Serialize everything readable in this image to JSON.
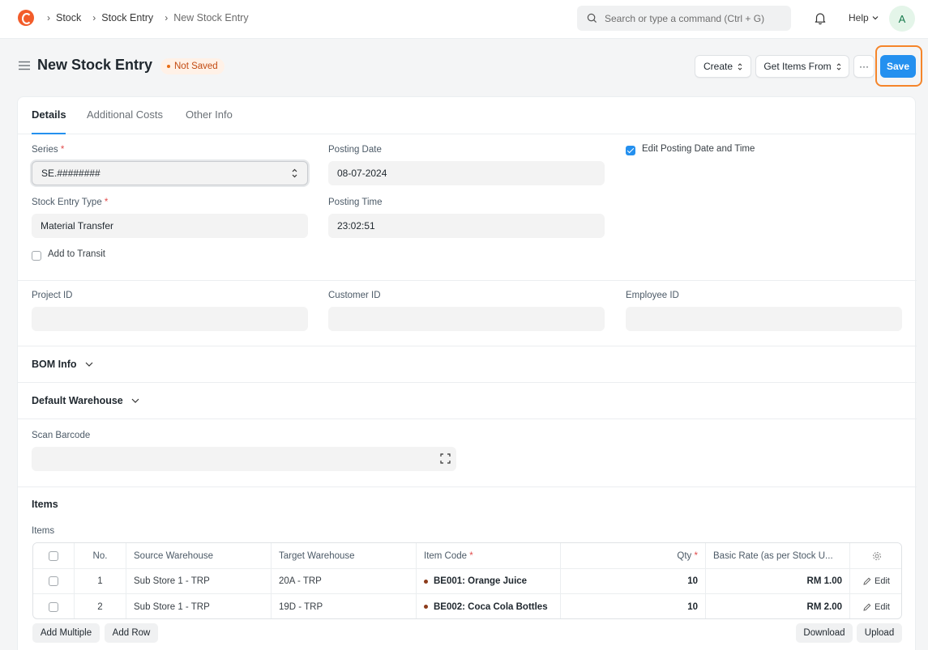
{
  "navbar": {
    "breadcrumbs": [
      "Stock",
      "Stock Entry",
      "New Stock Entry"
    ],
    "search_placeholder": "Search or type a command (Ctrl + G)",
    "help_label": "Help",
    "avatar_initial": "A"
  },
  "page": {
    "title": "New Stock Entry",
    "status": "Not Saved",
    "actions": {
      "create": "Create",
      "get_items_from": "Get Items From",
      "more": "···",
      "save": "Save"
    }
  },
  "tabs": [
    "Details",
    "Additional Costs",
    "Other Info"
  ],
  "form": {
    "series_label": "Series",
    "series_value": "SE.########",
    "posting_date_label": "Posting Date",
    "posting_date_value": "08-07-2024",
    "edit_posting_label": "Edit Posting Date and Time",
    "edit_posting_checked": true,
    "entry_type_label": "Stock Entry Type",
    "entry_type_value": "Material Transfer",
    "posting_time_label": "Posting Time",
    "posting_time_value": "23:02:51",
    "add_to_transit_label": "Add to Transit",
    "add_to_transit_checked": false,
    "project_id_label": "Project ID",
    "project_id_value": "",
    "customer_id_label": "Customer ID",
    "customer_id_value": "",
    "employee_id_label": "Employee ID",
    "employee_id_value": "",
    "bom_info_label": "BOM Info",
    "default_warehouse_label": "Default Warehouse",
    "scan_barcode_label": "Scan Barcode",
    "scan_barcode_value": "",
    "items_section_label": "Items",
    "items_table_label": "Items"
  },
  "items_table": {
    "columns": [
      "No.",
      "Source Warehouse",
      "Target Warehouse",
      "Item Code",
      "Qty",
      "Basic Rate (as per Stock U..."
    ],
    "rows": [
      {
        "no": "1",
        "source": "Sub Store 1 - TRP",
        "target": "20A - TRP",
        "item_code": "BE001: Orange Juice",
        "qty": "10",
        "rate": "RM 1.00",
        "edit": "Edit"
      },
      {
        "no": "2",
        "source": "Sub Store 1 - TRP",
        "target": "19D - TRP",
        "item_code": "BE002: Coca Cola Bottles",
        "qty": "10",
        "rate": "RM 2.00",
        "edit": "Edit"
      }
    ],
    "buttons": {
      "add_multiple": "Add Multiple",
      "add_row": "Add Row",
      "download": "Download",
      "upload": "Upload"
    }
  },
  "colors": {
    "primary": "#2490ef",
    "highlight": "#f5852a",
    "status_text": "#c24a11"
  }
}
